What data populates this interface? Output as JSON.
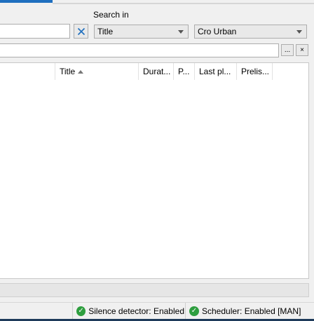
{
  "search": {
    "search_in_label": "Search in",
    "query_value": "",
    "field_selected": "Title",
    "library_selected": "Cro Urban",
    "filter_value": ""
  },
  "buttons": {
    "more_label": "...",
    "close_label": "×"
  },
  "table": {
    "columns": [
      {
        "label": "Title"
      },
      {
        "label": "Durat..."
      },
      {
        "label": "P..."
      },
      {
        "label": "Last pl..."
      },
      {
        "label": "Prelis..."
      }
    ],
    "sorted_column": "Title",
    "sort_direction": "ascending",
    "rows": []
  },
  "status": {
    "silence": "Silence detector: Enabled",
    "scheduler": "Scheduler: Enabled [MAN]"
  },
  "colors": {
    "accent": "#1f6fbf",
    "status_ok": "#2e9e3f"
  }
}
